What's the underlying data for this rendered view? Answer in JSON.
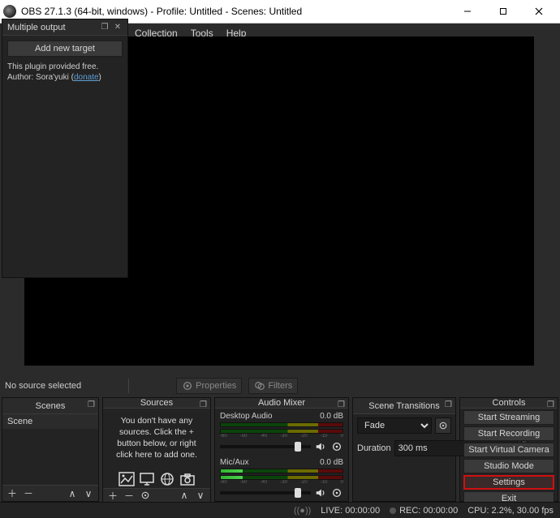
{
  "titlebar": {
    "title": "OBS 27.1.3 (64-bit, windows) - Profile: Untitled - Scenes: Untitled"
  },
  "menubar": {
    "collection": "Collection",
    "tools": "Tools",
    "help": "Help"
  },
  "plugin_panel": {
    "title": "Multiple output",
    "add_btn": "Add new target",
    "line1": "This plugin provided free.",
    "line2_prefix": "Author: Sora'yuki (",
    "line2_link": "donate",
    "line2_suffix": ")"
  },
  "src_toolbar": {
    "no_source": "No source selected",
    "properties": "Properties",
    "filters": "Filters"
  },
  "docks": {
    "scenes": {
      "title": "Scenes",
      "items": [
        "Scene"
      ]
    },
    "sources": {
      "title": "Sources",
      "empty": "You don't have any sources. Click the + button below, or right click here to add one."
    },
    "mixer": {
      "title": "Audio Mixer",
      "tracks": [
        {
          "name": "Desktop Audio",
          "db": "0.0 dB"
        },
        {
          "name": "Mic/Aux",
          "db": "0.0 dB"
        }
      ]
    },
    "transitions": {
      "title": "Scene Transitions",
      "selected": "Fade",
      "duration_label": "Duration",
      "duration_value": "300 ms"
    },
    "controls": {
      "title": "Controls",
      "buttons": {
        "start_streaming": "Start Streaming",
        "start_recording": "Start Recording",
        "start_vcam": "Start Virtual Camera",
        "studio_mode": "Studio Mode",
        "settings": "Settings",
        "exit": "Exit"
      }
    }
  },
  "statusbar": {
    "live": "LIVE: 00:00:00",
    "rec": "REC: 00:00:00",
    "cpu": "CPU: 2.2%, 30.00 fps"
  }
}
